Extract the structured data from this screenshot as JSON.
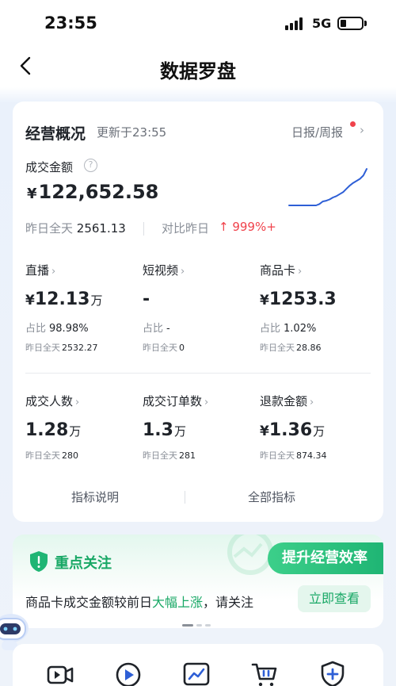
{
  "status_bar": {
    "time": "23:55",
    "network": "5G"
  },
  "nav": {
    "title": "数据罗盘"
  },
  "overview": {
    "title": "经营概况",
    "updated": "更新于23:55",
    "report_link": "日报/周报",
    "gmv_label": "成交金额",
    "gmv_currency": "¥",
    "gmv_value": "122,652.58",
    "yday_label": "昨日全天",
    "yday_value": "2561.13",
    "compare_label": "对比昨日",
    "compare_value": "↑ 999%+",
    "trend": [
      0,
      0,
      0,
      0,
      0,
      0,
      0,
      0,
      0,
      2,
      6,
      7,
      9,
      12,
      14,
      17,
      20,
      25,
      30,
      34,
      37,
      40,
      45,
      55
    ]
  },
  "metrics_row1": [
    {
      "label": "直播",
      "currency": "¥",
      "value": "12.13",
      "unit": "万",
      "share_label": "占比",
      "share": "98.98%",
      "yday_label": "昨日全天",
      "yday": "2532.27"
    },
    {
      "label": "短视频",
      "currency": "",
      "value": "-",
      "unit": "",
      "share_label": "占比",
      "share": "-",
      "yday_label": "昨日全天",
      "yday": "0"
    },
    {
      "label": "商品卡",
      "currency": "¥",
      "value": "1253.3",
      "unit": "",
      "share_label": "占比",
      "share": "1.02%",
      "yday_label": "昨日全天",
      "yday": "28.86"
    }
  ],
  "metrics_row2": [
    {
      "label": "成交人数",
      "currency": "",
      "value": "1.28",
      "unit": "万",
      "yday_label": "昨日全天",
      "yday": "280"
    },
    {
      "label": "成交订单数",
      "currency": "",
      "value": "1.3",
      "unit": "万",
      "yday_label": "昨日全天",
      "yday": "281"
    },
    {
      "label": "退款金额",
      "currency": "¥",
      "value": "1.36",
      "unit": "万",
      "yday_label": "昨日全天",
      "yday": "874.34"
    }
  ],
  "footer_links": {
    "metric_help": "指标说明",
    "all_metrics": "全部指标"
  },
  "focus": {
    "title": "重点关注",
    "banner": "提升经营效率",
    "text_before": "商品卡成交金额较前日",
    "text_highlight": "大幅上涨",
    "text_after": "，请关注",
    "button": "立即查看"
  },
  "tools": [
    "live-video-icon",
    "play-icon",
    "chart-icon",
    "cart-icon",
    "shield-plus-icon"
  ],
  "colors": {
    "accent_green": "#19a866",
    "up_red": "#f0424b",
    "trend_blue": "#2e5fd6"
  }
}
